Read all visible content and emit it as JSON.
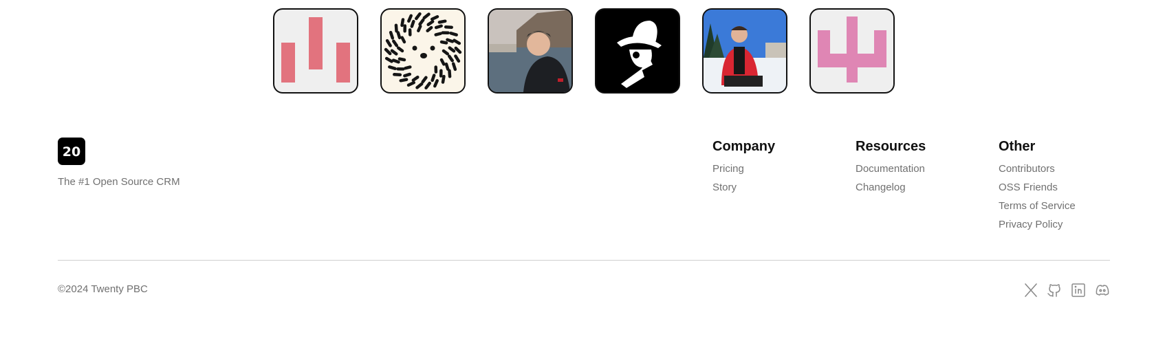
{
  "brand": {
    "logo_text": "20",
    "tagline": "The #1 Open Source CRM"
  },
  "contributors": [
    {
      "name": "avatar-bars"
    },
    {
      "name": "avatar-hedgehog"
    },
    {
      "name": "avatar-photo-lake"
    },
    {
      "name": "avatar-hat-illustration"
    },
    {
      "name": "avatar-photo-snow"
    },
    {
      "name": "avatar-pink-mark"
    }
  ],
  "footer": {
    "columns": [
      {
        "title": "Company",
        "links": [
          "Pricing",
          "Story"
        ]
      },
      {
        "title": "Resources",
        "links": [
          "Documentation",
          "Changelog"
        ]
      },
      {
        "title": "Other",
        "links": [
          "Contributors",
          "OSS Friends",
          "Terms of Service",
          "Privacy Policy"
        ]
      }
    ],
    "copyright": "©2024 Twenty PBC",
    "socials": [
      "x-icon",
      "github-icon",
      "linkedin-icon",
      "discord-icon"
    ]
  }
}
